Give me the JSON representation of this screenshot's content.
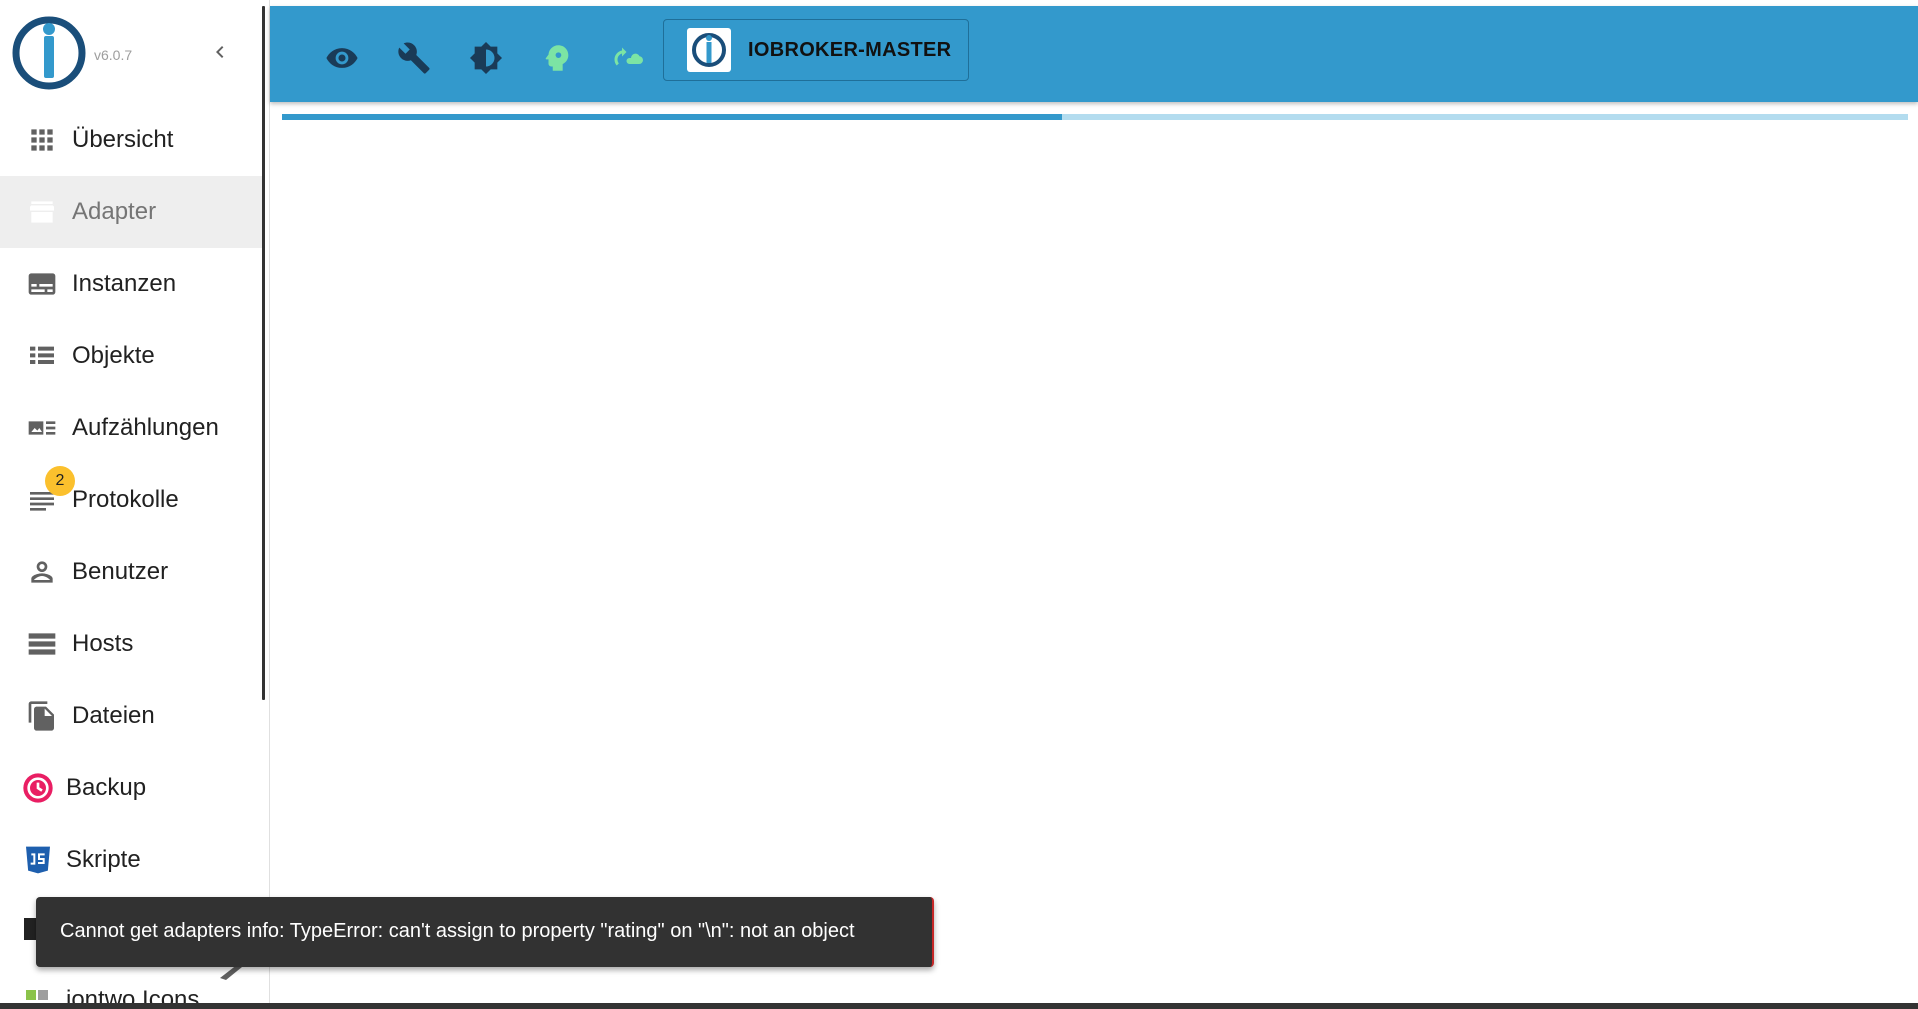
{
  "app": {
    "version": "v6.0.7",
    "host_name": "IOBROKER-MASTER"
  },
  "sidebar": {
    "items": [
      {
        "label": "Übersicht",
        "icon": "apps-grid-icon"
      },
      {
        "label": "Adapter",
        "icon": "store-icon",
        "active": true
      },
      {
        "label": "Instanzen",
        "icon": "subtitles-icon"
      },
      {
        "label": "Objekte",
        "icon": "view-list-icon"
      },
      {
        "label": "Aufzählungen",
        "icon": "art-track-icon"
      },
      {
        "label": "Protokolle",
        "icon": "notes-icon",
        "badge": "2"
      },
      {
        "label": "Benutzer",
        "icon": "person-icon"
      },
      {
        "label": "Hosts",
        "icon": "storage-icon"
      },
      {
        "label": "Dateien",
        "icon": "file-copy-icon"
      },
      {
        "label": "Backup",
        "icon": "backup-clock-icon"
      },
      {
        "label": "Skripte",
        "icon": "javascript-icon"
      },
      {
        "label": "iontwo Icons",
        "icon": "icons-adapter-icon"
      }
    ]
  },
  "topbar": {
    "buttons": [
      "eye-icon",
      "wrench-icon",
      "theme-brightness-icon",
      "expert-mode-head-icon",
      "cloud-sync-icon"
    ]
  },
  "progress": {
    "value": 0.48
  },
  "snackbar": {
    "message": "Cannot get adapters info: TypeError: can't assign to property \"rating\" on \"\\n\": not an object"
  },
  "colors": {
    "primary": "#3399cc",
    "badge": "#fbc02d",
    "expert_mode": "#7ce4a4",
    "backup": "#e91e63",
    "javascript": "#1e5fae"
  }
}
